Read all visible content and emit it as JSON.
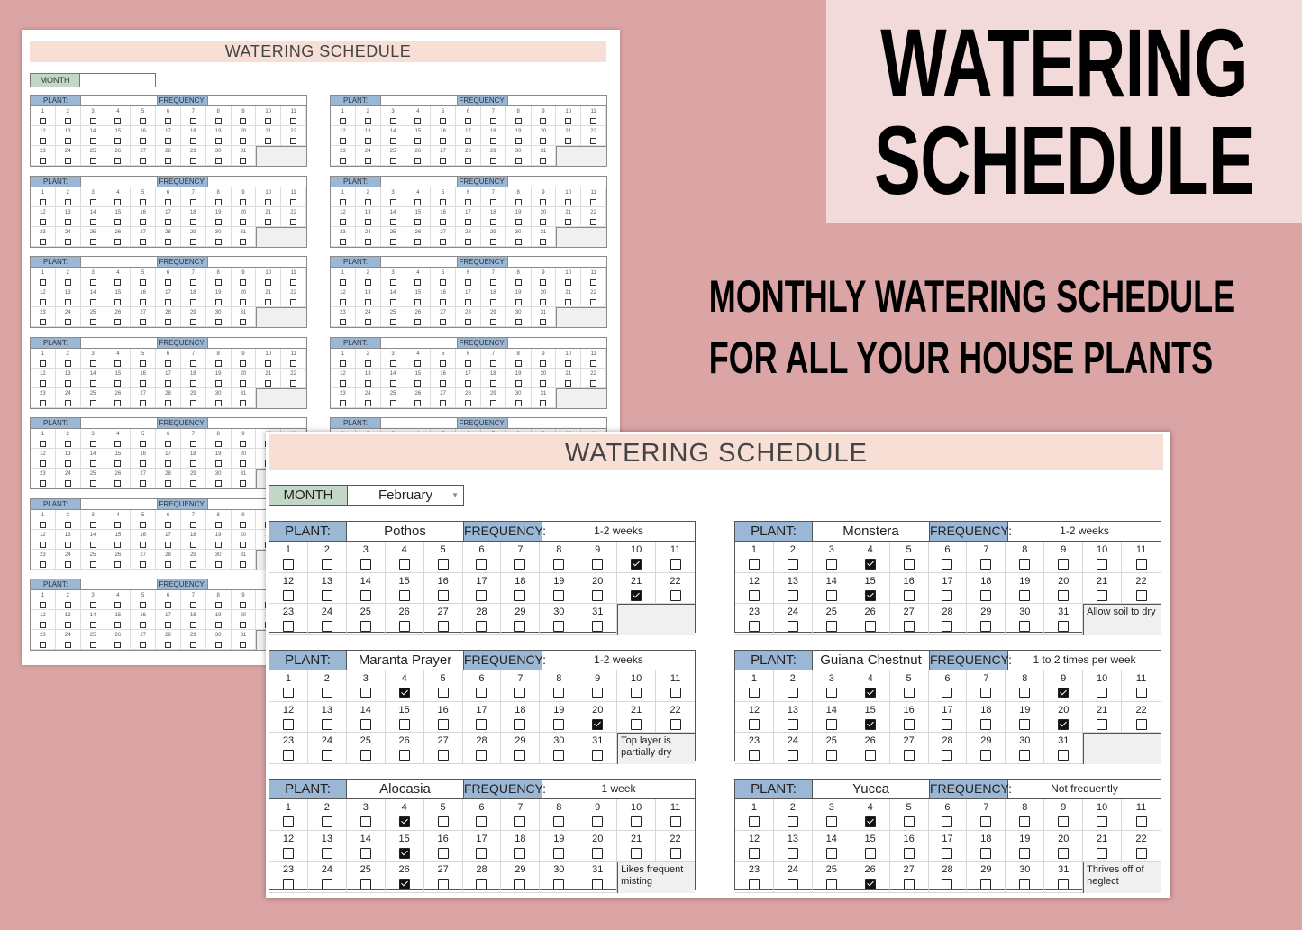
{
  "hero": {
    "line1": "WATERING",
    "line2": "SCHEDULE"
  },
  "tagline": {
    "line1": "MONTHLY WATERING SCHEDULE",
    "line2": "FOR ALL YOUR HOUSE PLANTS"
  },
  "colors": {
    "background": "#dba4a5",
    "hero_card": "#f2d9da",
    "title_bar": "#f8dfd5",
    "month_label": "#c3d7c7",
    "header_label": "#9bb7d6"
  },
  "background_sheet": {
    "title": "WATERING SCHEDULE",
    "month_label": "MONTH",
    "plant_label": "PLANT:",
    "frequency_label": "FREQUENCY:",
    "card_count": 14
  },
  "sheet": {
    "title": "WATERING SCHEDULE",
    "month_label": "MONTH",
    "month_value": "February",
    "plant_label": "PLANT:",
    "frequency_label": "FREQUENCY:",
    "days": [
      1,
      2,
      3,
      4,
      5,
      6,
      7,
      8,
      9,
      10,
      11,
      12,
      13,
      14,
      15,
      16,
      17,
      18,
      19,
      20,
      21,
      22,
      23,
      24,
      25,
      26,
      27,
      28,
      29,
      30,
      31
    ],
    "plants": [
      {
        "name": "Pothos",
        "frequency": "1-2 weeks",
        "checked": [
          10,
          21
        ],
        "note": ""
      },
      {
        "name": "Monstera",
        "frequency": "1-2 weeks",
        "checked": [
          4,
          15
        ],
        "note": "Allow soil to dry"
      },
      {
        "name": "Maranta Prayer",
        "frequency": "1-2 weeks",
        "checked": [
          4,
          20
        ],
        "note": "Top layer is partially dry"
      },
      {
        "name": "Guiana Chestnut",
        "frequency": "1 to 2 times per week",
        "checked": [
          4,
          9,
          15,
          20
        ],
        "note": ""
      },
      {
        "name": "Alocasia",
        "frequency": "1 week",
        "checked": [
          4,
          15,
          26
        ],
        "note": "Likes frequent misting"
      },
      {
        "name": "Yucca",
        "frequency": "Not frequently",
        "checked": [
          4,
          26
        ],
        "note": "Thrives off of neglect"
      }
    ]
  }
}
